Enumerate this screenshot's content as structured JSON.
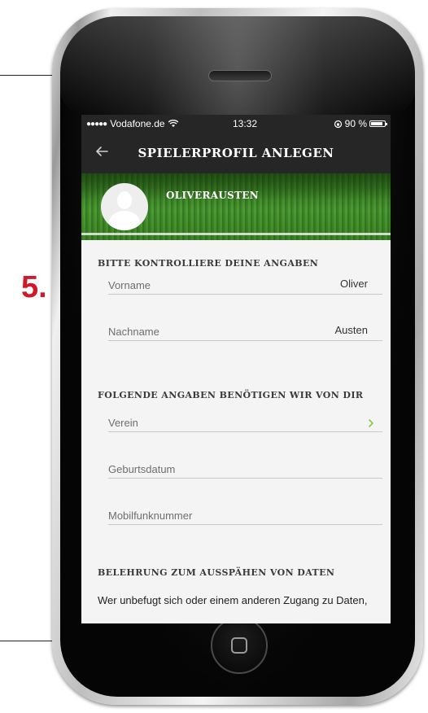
{
  "annotation": {
    "step_label": "5."
  },
  "status_bar": {
    "carrier": "Vodafone.de",
    "time": "13:32",
    "battery": "90 %",
    "battery_level": 0.9
  },
  "nav": {
    "title": "SPIELERPROFIL ANLEGEN"
  },
  "profile": {
    "name": "OLIVERAUSTEN"
  },
  "section_check": {
    "heading": "BITTE KONTROLLIERE DEINE ANGABEN",
    "fields": [
      {
        "label": "Vorname",
        "value": "Oliver"
      },
      {
        "label": "Nachname",
        "value": "Austen"
      }
    ]
  },
  "section_required": {
    "heading": "FOLGENDE ANGABEN BENÖTIGEN WIR VON DIR",
    "fields": [
      {
        "label": "Verein"
      },
      {
        "label": "Geburtsdatum"
      },
      {
        "label": "Mobilfunknummer"
      }
    ]
  },
  "section_info": {
    "heading": "BELEHRUNG ZUM AUSSPÄHEN VON DATEN",
    "text": "Wer unbefugt sich oder einem anderen Zugang zu Daten,"
  },
  "colors": {
    "accent_green": "#8cc63f",
    "step_red": "#cf1a2a",
    "nav_dark": "#262626"
  }
}
